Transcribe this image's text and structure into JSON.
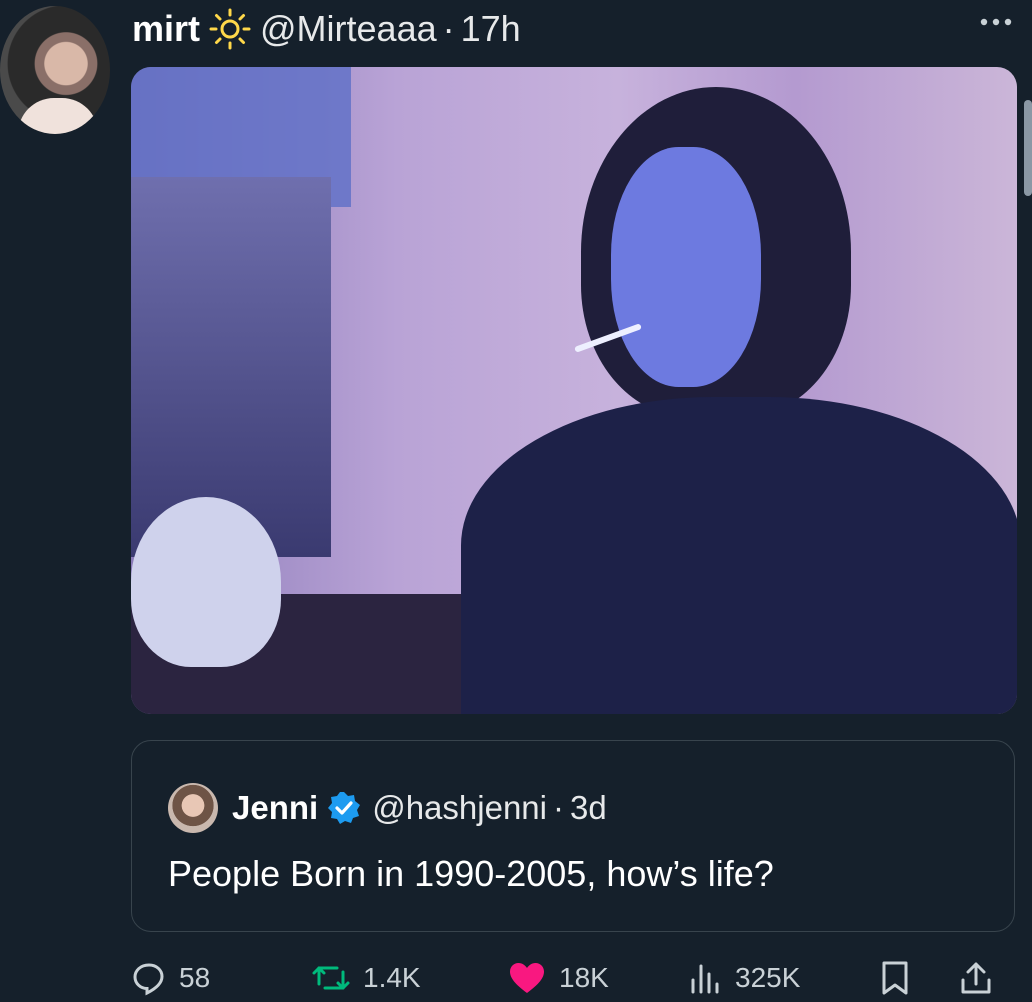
{
  "author": {
    "name": "mirt",
    "handle": "@Mirteaaa",
    "dot": "·",
    "time": "17h",
    "name_emoji": "sun-icon"
  },
  "quoted": {
    "name": "Jenni",
    "handle": "@hashjenni",
    "dot": "·",
    "time": "3d",
    "text": "People Born in 1990-2005, how’s life?"
  },
  "actions": {
    "replies": "58",
    "retweets": "1.4K",
    "likes": "18K",
    "views": "325K"
  },
  "colors": {
    "background": "#15202b",
    "like": "#f91880",
    "verified": "#1d9bf0",
    "sun": "#ffd84a"
  },
  "icons": [
    "more-icon",
    "reply-icon",
    "retweet-icon",
    "heart-icon",
    "views-icon",
    "bookmark-icon",
    "share-icon",
    "verified-icon"
  ]
}
